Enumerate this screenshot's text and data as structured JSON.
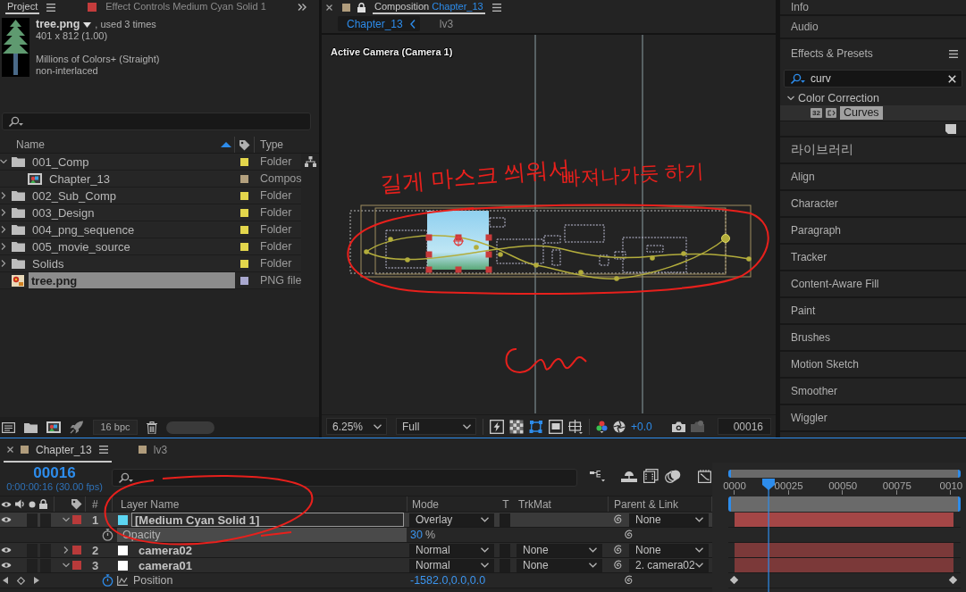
{
  "project_panel": {
    "tabs": [
      {
        "label": "Project",
        "selected": true
      },
      {
        "label": "Effect Controls Medium Cyan Solid 1",
        "selected": false
      }
    ],
    "footage": {
      "name": "tree.png",
      "usage": ", used 3 times",
      "dimensions": "401 x 812 (1.00)",
      "colors": "Millions of Colors+ (Straight)",
      "field_order": "non-interlaced"
    },
    "columns": [
      {
        "label": "Name",
        "sorted": true
      },
      {
        "label": "Type",
        "sorted": false
      }
    ],
    "items": [
      {
        "name": "001_Comp",
        "kind": "folder",
        "type": "Folder",
        "color": "#e3d64c",
        "expanded": true,
        "selected": false,
        "children": [
          {
            "name": "Chapter_13",
            "kind": "composition",
            "type": "Compos",
            "color": "#b3a07e",
            "selected": false
          }
        ]
      },
      {
        "name": "002_Sub_Comp",
        "kind": "folder",
        "type": "Folder",
        "color": "#e3d64c",
        "expanded": false,
        "selected": false
      },
      {
        "name": "003_Design",
        "kind": "folder",
        "type": "Folder",
        "color": "#e3d64c",
        "expanded": false,
        "selected": false
      },
      {
        "name": "004_png_sequence",
        "kind": "folder",
        "type": "Folder",
        "color": "#e3d64c",
        "expanded": false,
        "selected": false
      },
      {
        "name": "005_movie_source",
        "kind": "folder",
        "type": "Folder",
        "color": "#e3d64c",
        "expanded": false,
        "selected": false
      },
      {
        "name": "Solids",
        "kind": "folder",
        "type": "Folder",
        "color": "#e3d64c",
        "expanded": false,
        "selected": false
      },
      {
        "name": "tree.png",
        "kind": "image",
        "type": "PNG file",
        "color": "#a9a8cf",
        "selected": true
      }
    ],
    "bit_depth": "16 bpc"
  },
  "composition_panel": {
    "tab": {
      "label": "Composition",
      "name": "Chapter_13"
    },
    "breadcrumbs": [
      {
        "label": "Chapter_13",
        "selected": true
      },
      {
        "label": "lv3",
        "selected": false
      }
    ],
    "view_label": "Active Camera (Camera 1)",
    "notes": [
      "길게 마스크 씌워서",
      "빠져나가듯 하기"
    ],
    "zoom": "6.25%",
    "resolution": "Full",
    "toggles": [
      {
        "kind": "fast_previews",
        "on": false
      },
      {
        "kind": "transparency_grid",
        "on": false
      },
      {
        "kind": "mask_visibility",
        "on": true
      },
      {
        "kind": "region_of_interest",
        "on": false
      },
      {
        "kind": "grid_guides",
        "on": false
      }
    ],
    "exposure": "+0.0",
    "current_time": "00016"
  },
  "right_panel": {
    "panels": [
      "Info",
      "Audio"
    ],
    "effects": {
      "title": "Effects & Presets",
      "search": "curv",
      "groups": [
        {
          "name": "Color Correction",
          "expanded": true,
          "children": [
            {
              "name": "Curves",
              "badge": "32",
              "selected": true
            }
          ]
        }
      ]
    },
    "more_panels": [
      "라이브러리",
      "Align",
      "Character",
      "Paragraph",
      "Tracker",
      "Content-Aware Fill",
      "Paint",
      "Brushes",
      "Motion Sketch",
      "Smoother",
      "Wiggler"
    ]
  },
  "timeline": {
    "tabs": [
      {
        "label": "Chapter_13",
        "selected": true
      },
      {
        "label": "lv3",
        "selected": false
      }
    ],
    "current_time": "00016",
    "timecode": "0:00:00:16 (30.00 fps)",
    "ruler": [
      "0000",
      "00025",
      "00050",
      "00075",
      "0010"
    ],
    "playhead": {
      "level": 0.173
    },
    "columns": {
      "number": "#",
      "name": "Layer Name",
      "mode": "Mode",
      "t": "T",
      "track_matte": "TrkMat",
      "parent": "Parent & Link"
    },
    "layers": [
      {
        "number": "1",
        "name": "[Medium Cyan Solid 1]",
        "color": "#5cd6f2",
        "visible": true,
        "expanded": true,
        "selected": true,
        "editing": true,
        "mode": "Overlay",
        "parent": "None",
        "properties": [
          {
            "name": "Opacity",
            "value": "30",
            "unit": "%",
            "animated": false,
            "selected": true
          }
        ]
      },
      {
        "number": "2",
        "name": "camera02",
        "color": "#ffffff",
        "visible": true,
        "expanded": false,
        "selected": false,
        "editing": false,
        "mode": "Normal",
        "track_matte": "None",
        "parent": "None"
      },
      {
        "number": "3",
        "name": "camera01",
        "color": "#ffffff",
        "visible": true,
        "expanded": true,
        "selected": false,
        "editing": false,
        "mode": "Normal",
        "track_matte": "None",
        "parent": "2. camera02",
        "properties": [
          {
            "name": "Position",
            "value": "-1582.0,0.0,0.0",
            "animated": true,
            "selected": false,
            "keyframes": [
              {
                "level": 0.023
              },
              {
                "level": 0.965
              }
            ]
          }
        ]
      }
    ]
  }
}
